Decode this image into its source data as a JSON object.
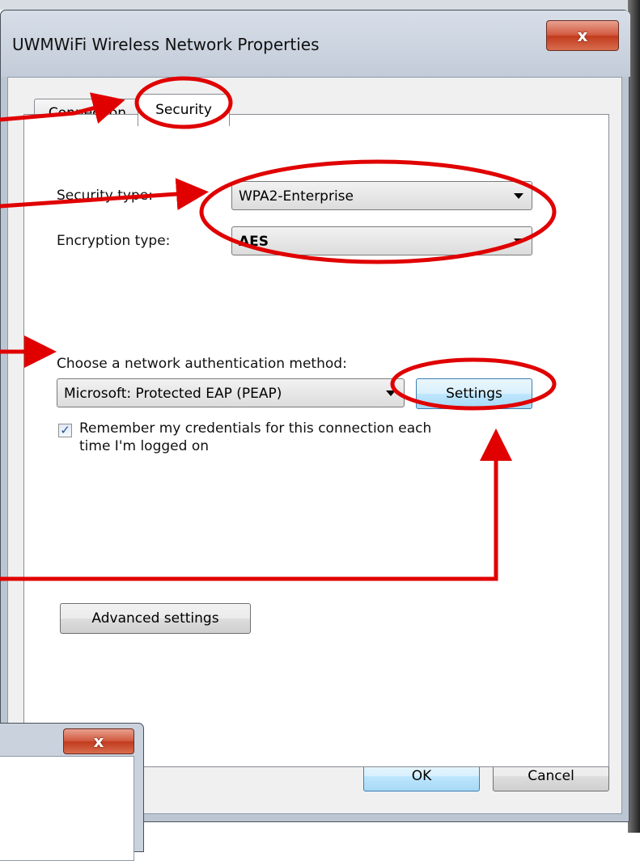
{
  "window": {
    "title": "UWMWiFi Wireless Network Properties",
    "close_glyph": "x"
  },
  "tabs": [
    {
      "label": "Connection",
      "active": false
    },
    {
      "label": "Security",
      "active": true
    }
  ],
  "security": {
    "security_type_label": "Security type:",
    "security_type_value": "WPA2-Enterprise",
    "encryption_type_label": "Encryption type:",
    "encryption_type_value": "AES",
    "auth_method_label": "Choose a network authentication method:",
    "auth_method_value": "Microsoft: Protected EAP (PEAP)",
    "settings_button": "Settings",
    "remember_checked": true,
    "remember_line1": "Remember my credentials for this connection each",
    "remember_line2": "time I'm logged on",
    "advanced_button": "Advanced settings"
  },
  "footer": {
    "ok_button": "OK",
    "cancel_button": "Cancel"
  },
  "background_window": {
    "close_glyph": "x"
  },
  "colors": {
    "annotation_red": "#e00000",
    "close_red": "#c23b1e",
    "focus_blue": "#3c7fb1"
  },
  "icons": [
    "close-icon",
    "dropdown-arrow-icon",
    "checkmark-icon"
  ]
}
